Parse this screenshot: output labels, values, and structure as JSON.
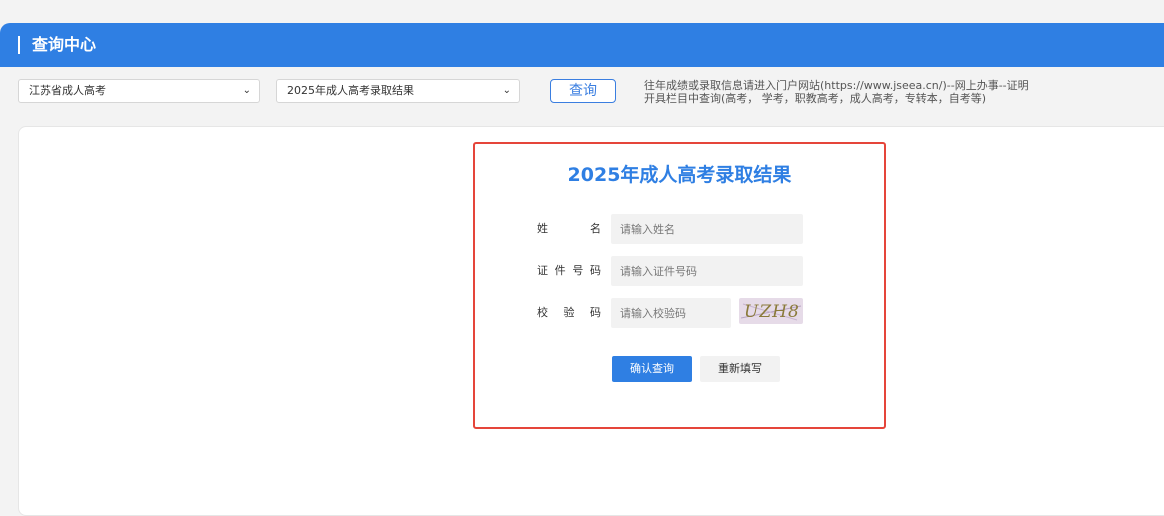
{
  "header": {
    "title": "查询中心"
  },
  "filters": {
    "region_select": {
      "selected": "江苏省成人高考"
    },
    "exam_select": {
      "selected": "2025年成人高考录取结果"
    },
    "query_button_label": "查询",
    "notice_lines": [
      "往年成绩或录取信息请进入门户网站(https://www.jseea.cn/)--网上办事--证明",
      "开具栏目中查询(高考， 学考，职教高考，成人高考，专转本，自考等)"
    ]
  },
  "form": {
    "title": "2025年成人高考录取结果",
    "fields": [
      {
        "label_chars": [
          "姓",
          "名"
        ],
        "placeholder": "请输入姓名"
      },
      {
        "label_chars": [
          "证",
          "件",
          "号",
          "码"
        ],
        "placeholder": "请输入证件号码"
      },
      {
        "label_chars": [
          "校",
          "验",
          "码"
        ],
        "placeholder": "请输入校验码"
      }
    ],
    "captcha_text": "UZH8",
    "confirm_label": "确认查询",
    "reset_label": "重新填写"
  },
  "colors": {
    "primary": "#2f7fe3",
    "highlight_border": "#e5453a",
    "input_bg": "#f2f2f2"
  },
  "icons": {
    "select_chevron": "chevron-down-icon"
  }
}
